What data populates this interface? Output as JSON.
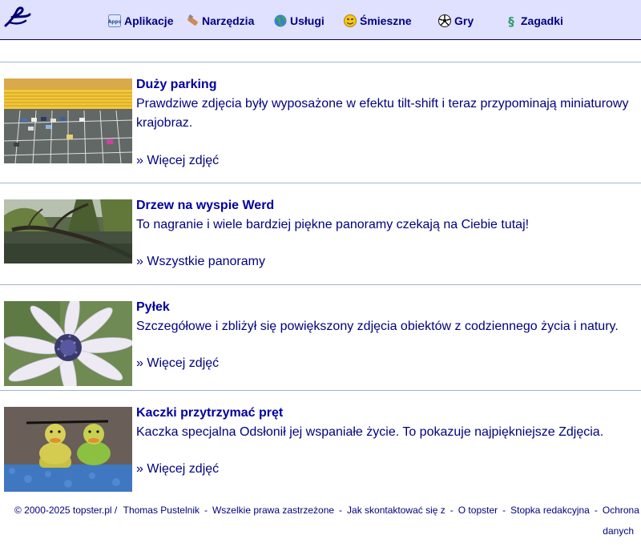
{
  "header": {
    "logo": "topster-logo",
    "nav": [
      {
        "label": "Aplikacje",
        "icon": "apps-icon"
      },
      {
        "label": "Narzędzia",
        "icon": "tools-icon"
      },
      {
        "label": "Usługi",
        "icon": "globe-icon"
      },
      {
        "label": "Śmieszne",
        "icon": "smiley-icon"
      },
      {
        "label": "Gry",
        "icon": "soccer-ball-icon"
      },
      {
        "label": "Zagadki",
        "icon": "puzzle-icon"
      }
    ]
  },
  "articles": [
    {
      "title": "Duży parking",
      "description": "Prawdziwe zdjęcia były wyposażone w efektu tilt-shift i teraz przypominają miniaturowy krajobraz.",
      "more": "» Więcej zdjęć"
    },
    {
      "title": "Drzew na wyspie Werd",
      "description": "To nagranie i wiele bardziej piękne panoramy czekają na Ciebie tutaj!",
      "more": "» Wszystkie panoramy"
    },
    {
      "title": "Pyłek",
      "description": "Szczegółowe i zbliżył się powiększony zdjęcia obiektów z codziennego życia i natury.",
      "more": "» Więcej zdjęć"
    },
    {
      "title": "Kaczki przytrzymać pręt",
      "description": "Kaczka specjalna Odsłonił jej wspaniałe życie. To pokazuje najpiękniejsze Zdjęcia.",
      "more": "» Więcej zdjęć"
    }
  ],
  "footer": {
    "copyright": "© 2000-2025 topster.pl /",
    "author": "Thomas Pustelnik",
    "rights": "Wszelkie prawa zastrzeżone",
    "contact": "Jak skontaktować się z",
    "about": "O topster",
    "imprint": "Stopka redakcyjna",
    "privacy_1": "Ochrona",
    "privacy_2": "danych"
  }
}
